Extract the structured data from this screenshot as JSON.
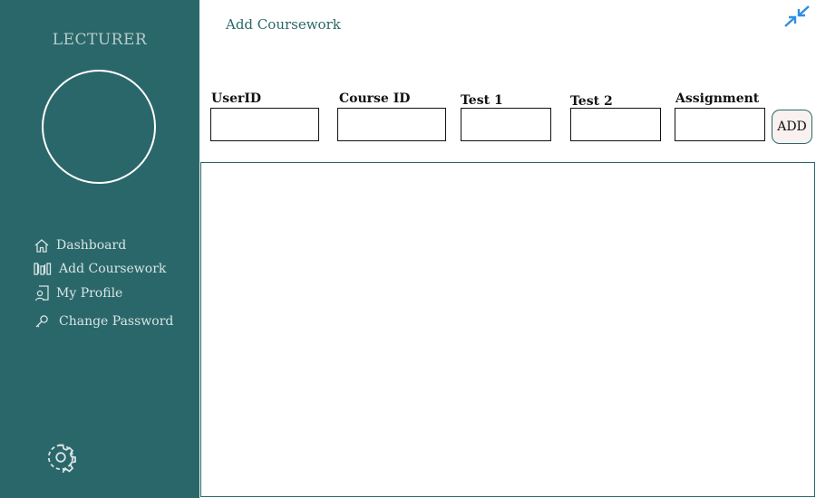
{
  "sidebar": {
    "role_title": "LECTURER",
    "nav": [
      {
        "label": "Dashboard",
        "icon": "home-icon"
      },
      {
        "label": "Add Coursework",
        "icon": "bar-chart-icon"
      },
      {
        "label": "My Profile",
        "icon": "profile-document-icon"
      },
      {
        "label": "Change Password",
        "icon": "key-icon"
      }
    ],
    "settings_icon": "gear-icon"
  },
  "header": {
    "title": "Add Coursework",
    "collapse_icon": "collapse-arrows-icon"
  },
  "form": {
    "fields": [
      {
        "label": "UserID",
        "value": "",
        "placeholder": ""
      },
      {
        "label": "Course ID",
        "value": "",
        "placeholder": ""
      },
      {
        "label": "Test 1",
        "value": "",
        "placeholder": ""
      },
      {
        "label": "Test 2",
        "value": "",
        "placeholder": ""
      },
      {
        "label": "Assignment",
        "value": "",
        "placeholder": ""
      }
    ],
    "add_label": "ADD"
  },
  "colors": {
    "sidebar_bg": "#2a676a",
    "accent_blue": "#2f8fe0",
    "button_bg": "#f8f1ef"
  }
}
